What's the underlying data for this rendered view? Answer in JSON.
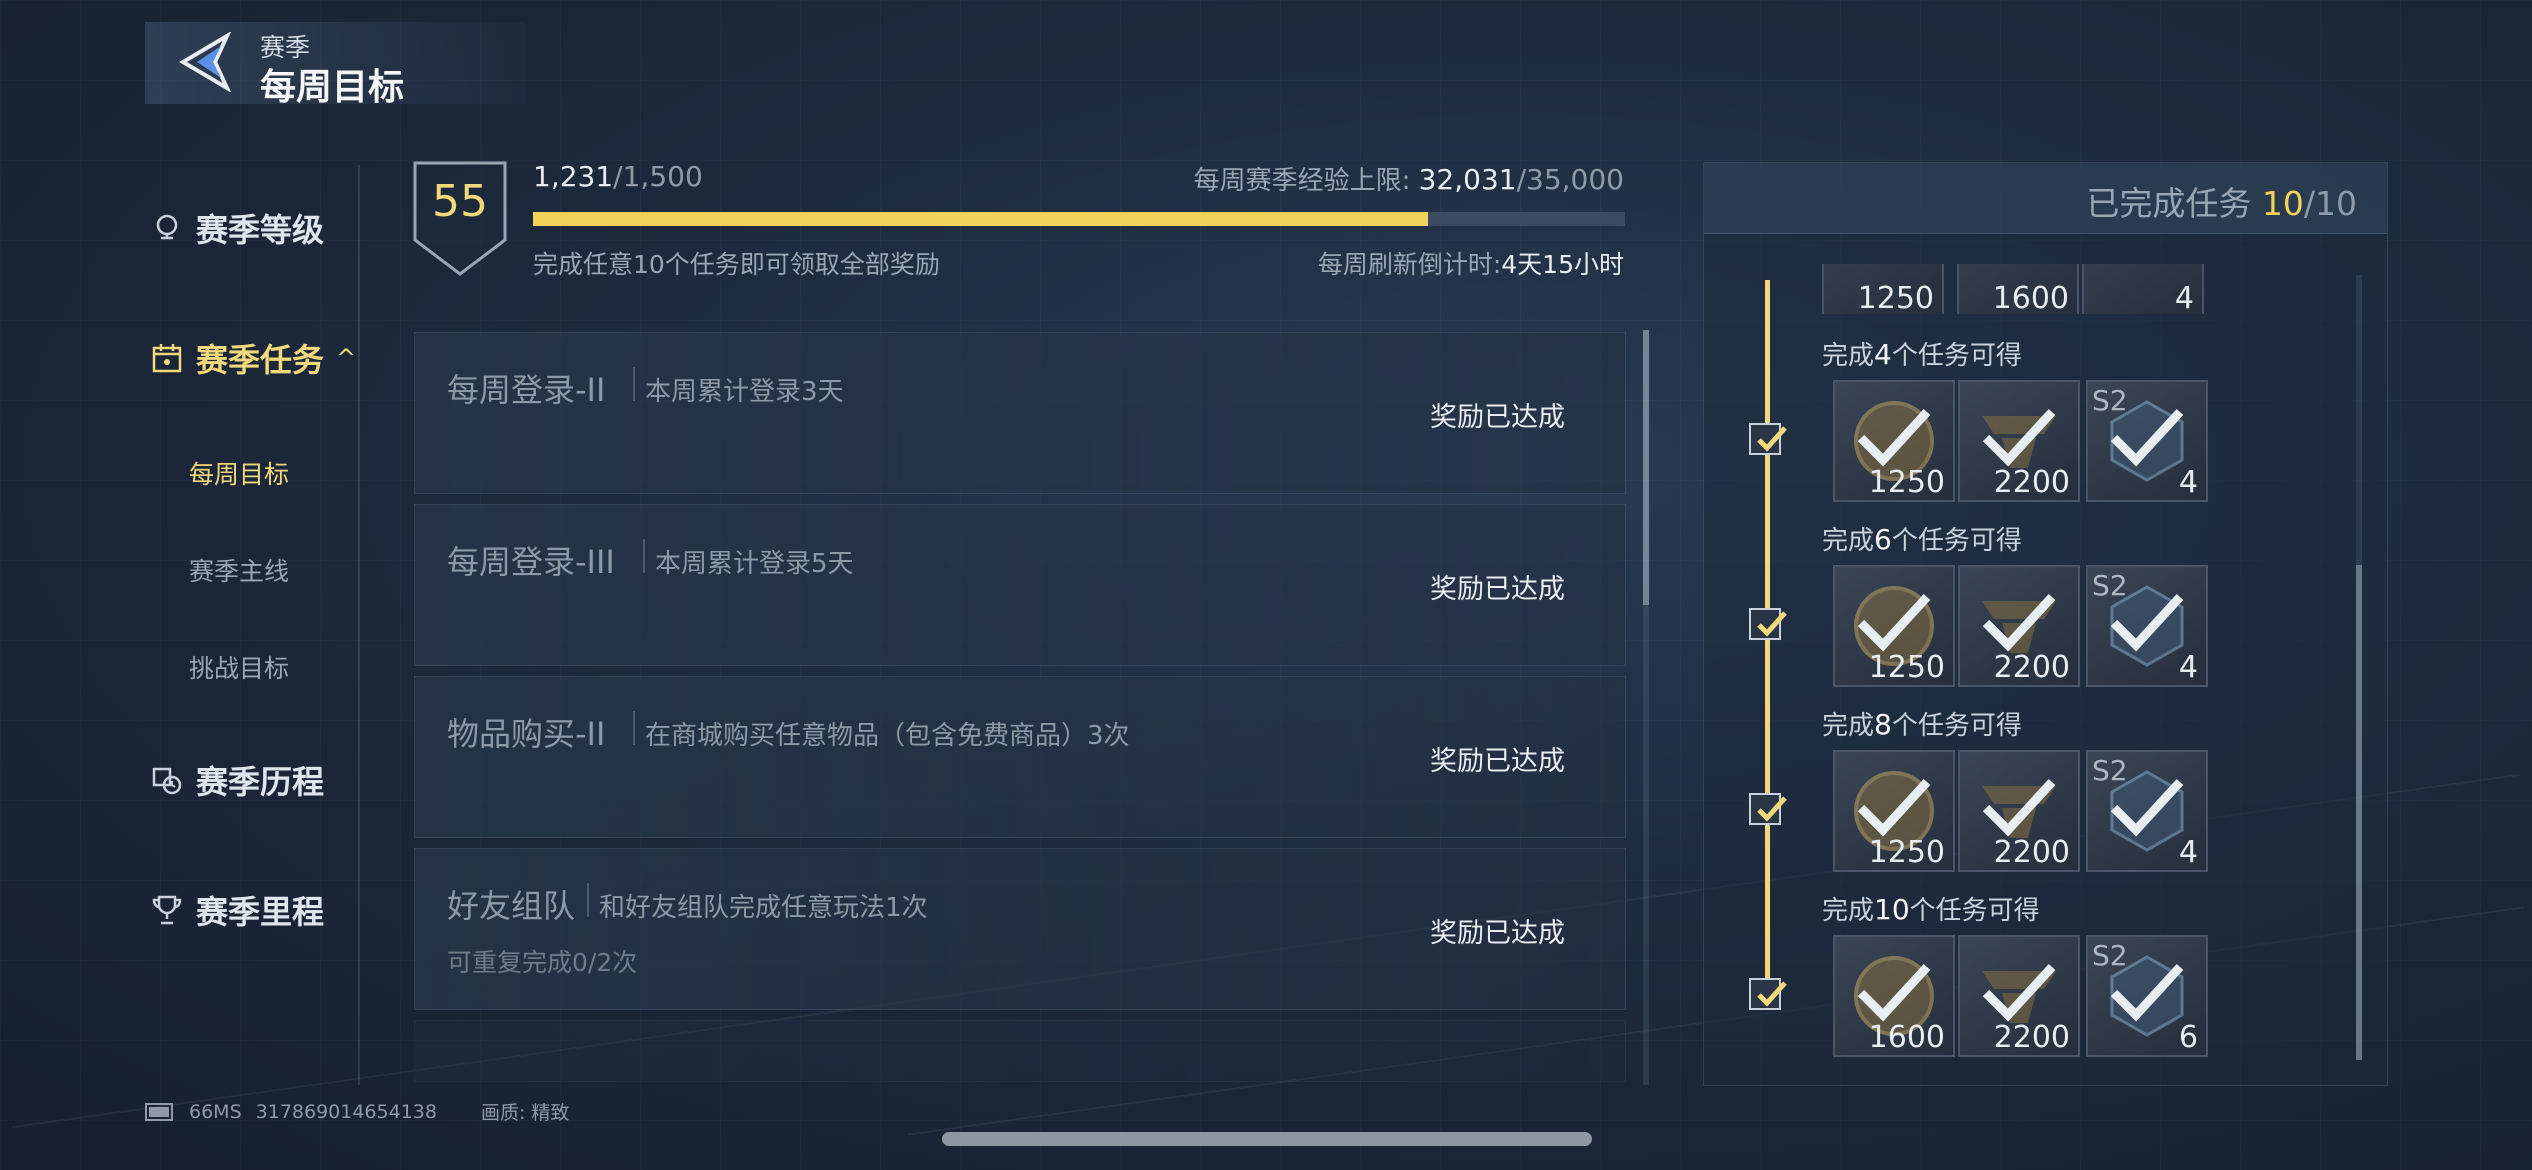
{
  "header": {
    "subtitle": "赛季",
    "title": "每周目标"
  },
  "sidebar": {
    "items": [
      {
        "label": "赛季等级"
      },
      {
        "label": "赛季任务",
        "expander": "^"
      },
      {
        "label": "赛季历程"
      },
      {
        "label": "赛季里程"
      }
    ],
    "sub_items": [
      {
        "label": "每周目标"
      },
      {
        "label": "赛季主线"
      },
      {
        "label": "挑战目标"
      }
    ]
  },
  "progress": {
    "level": "55",
    "xp_current": "1,231",
    "xp_total": "/1,500",
    "xp_fraction": 0.82,
    "weekly_cap_label": "每周赛季经验上限:",
    "weekly_cap_current": "32,031",
    "weekly_cap_total": "/35,000",
    "hint": "完成任意10个任务即可领取全部奖励",
    "refresh_label": "每周刷新倒计时:",
    "refresh_value": "4天15小时"
  },
  "tasks": [
    {
      "name": "每周登录-II",
      "desc": "本周累计登录3天",
      "status": "奖励已达成"
    },
    {
      "name": "每周登录-III",
      "desc": "本周累计登录5天",
      "status": "奖励已达成"
    },
    {
      "name": "物品购买-II",
      "desc": "在商城购买任意物品（包含免费商品）3次",
      "status": "奖励已达成"
    },
    {
      "name": "好友组队",
      "desc": "和好友组队完成任意玩法1次",
      "status": "奖励已达成",
      "repeat": "可重复完成0/2次"
    }
  ],
  "rewards_panel": {
    "title": "已完成任务",
    "done": "10",
    "total": "/10",
    "partial_row": [
      "1250",
      "1600",
      "4"
    ],
    "groups": [
      {
        "pre": "完成",
        "n": "4",
        "post": "个任务可得",
        "rewards": [
          "1250",
          "2200",
          "4"
        ],
        "badge": "S2"
      },
      {
        "pre": "完成",
        "n": "6",
        "post": "个任务可得",
        "rewards": [
          "1250",
          "2200",
          "4"
        ],
        "badge": "S2"
      },
      {
        "pre": "完成",
        "n": "8",
        "post": "个任务可得",
        "rewards": [
          "1250",
          "2200",
          "4"
        ],
        "badge": "S2"
      },
      {
        "pre": "完成",
        "n": "10",
        "post": "个任务可得",
        "rewards": [
          "1600",
          "2200",
          "6"
        ],
        "badge": "S2"
      }
    ]
  },
  "footer": {
    "ping": "66MS",
    "uid": "317869014654138",
    "quality": "画质: 精致"
  }
}
